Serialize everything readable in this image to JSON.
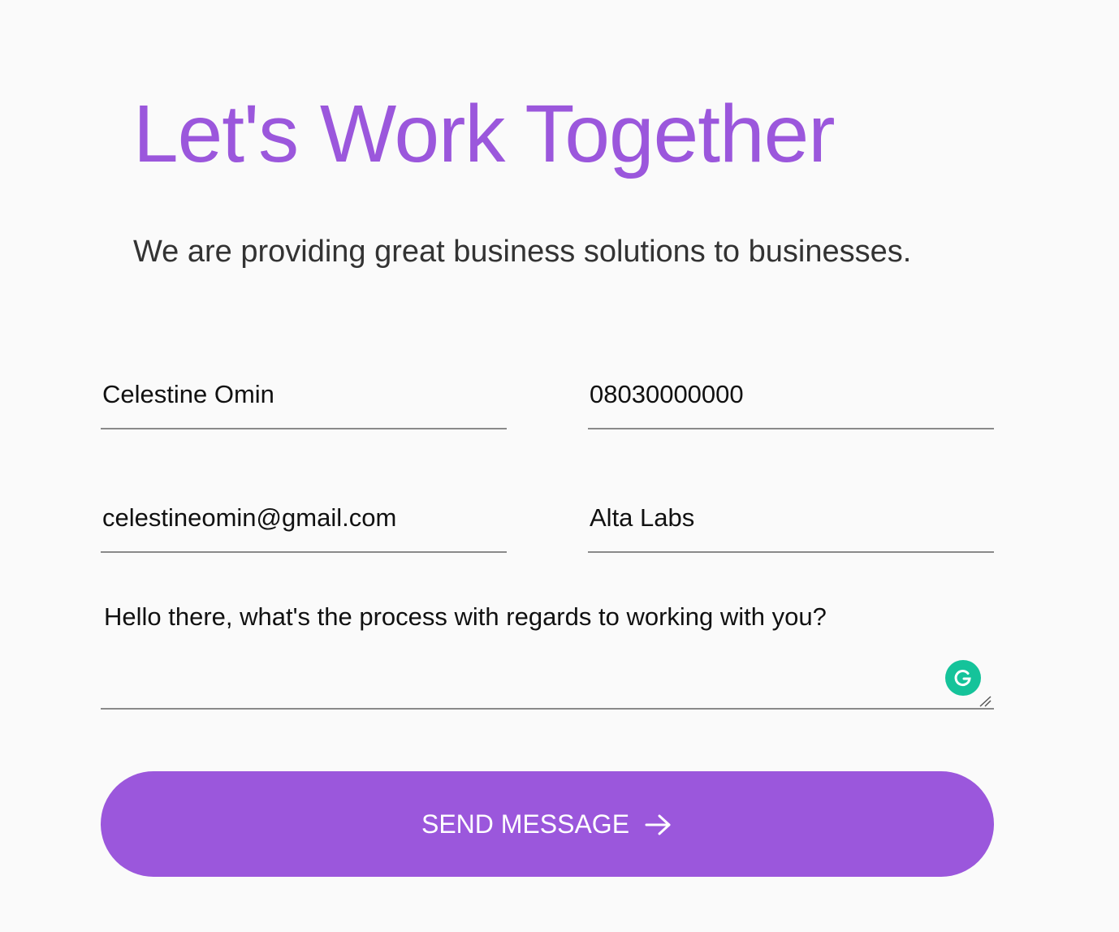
{
  "header": {
    "title": "Let's Work Together",
    "subtitle": "We are providing great business solutions to businesses."
  },
  "form": {
    "name": {
      "value": "Celestine Omin"
    },
    "phone": {
      "value": "08030000000"
    },
    "email": {
      "value": "celestineomin@gmail.com"
    },
    "company": {
      "value": "Alta Labs"
    },
    "message": {
      "value": "Hello there, what's the process with regards to working with you?"
    },
    "submit_label": "SEND MESSAGE",
    "submit_icon": "arrow-right-icon"
  },
  "extension": {
    "icon": "grammarly-icon",
    "color": "#15c39a"
  },
  "colors": {
    "accent": "#9b57dc",
    "background": "#fafafa",
    "underline": "#8a8a8a"
  }
}
